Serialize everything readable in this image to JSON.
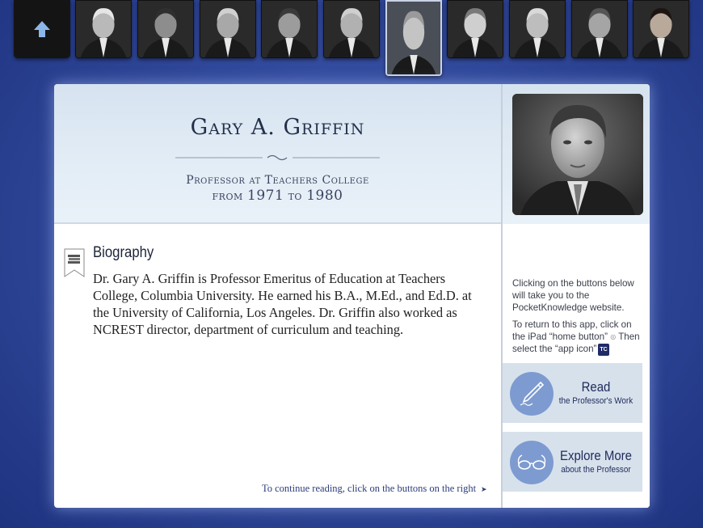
{
  "nav": {
    "home_icon": "home-arrow-icon",
    "thumbnails": [
      {
        "name": "professor-portrait-1"
      },
      {
        "name": "professor-portrait-2"
      },
      {
        "name": "professor-portrait-3"
      },
      {
        "name": "professor-portrait-4"
      },
      {
        "name": "professor-portrait-5"
      },
      {
        "name": "professor-portrait-6",
        "active": true
      },
      {
        "name": "professor-portrait-7"
      },
      {
        "name": "professor-portrait-8"
      },
      {
        "name": "professor-portrait-9"
      },
      {
        "name": "professor-portrait-10"
      }
    ]
  },
  "profile": {
    "name": "Gary A. Griffin",
    "role": "Professor at Teachers College",
    "tenure_prefix": "from",
    "start_year": "1971",
    "tenure_mid": "to",
    "end_year": "1980"
  },
  "biography": {
    "heading": "Biography",
    "icon": "book-stack-icon",
    "text": "Dr. Gary A. Griffin is Professor Emeritus of Education at Teachers College, Columbia University. He earned his B.A., M.Ed., and Ed.D. at the University of California, Los Angeles. Dr. Griffin also worked as NCREST director, department of curriculum and teaching."
  },
  "footer_note": "To continue reading, click on the buttons on the right",
  "sidebar": {
    "instruction_1": "Clicking on the buttons below will take you to the PocketKnowledge website.",
    "instruction_2a": "To return to this app, click on the iPad “home button”",
    "instruction_2b": "Then select the “app icon”",
    "tc_badge": "TC",
    "read_button": {
      "title": "Read",
      "subtitle": "the Professor's Work",
      "icon": "pen-nib-icon"
    },
    "explore_button": {
      "title": "Explore More",
      "subtitle": "about the Professor",
      "icon": "eyeglasses-icon"
    }
  },
  "colors": {
    "background": "#324a9c",
    "accent": "#7d9bd0",
    "button_bg": "#d7e1ec",
    "header_bg": "#dde8f3",
    "title_text": "#24304a"
  }
}
